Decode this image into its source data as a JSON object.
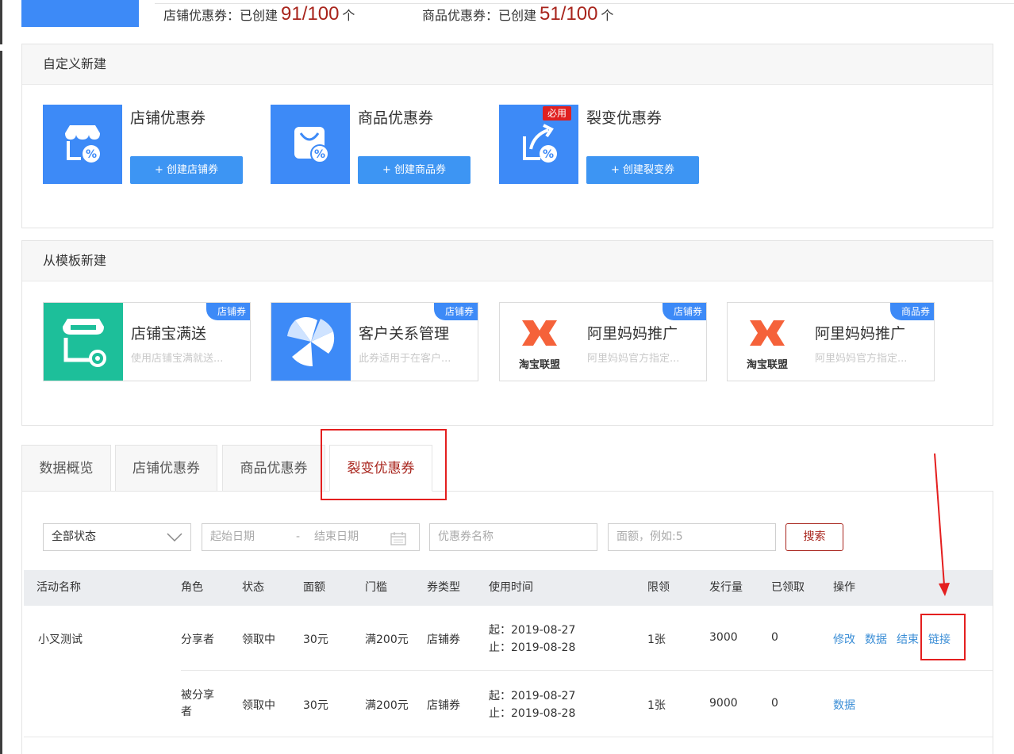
{
  "stats": {
    "shop": {
      "label": "店铺优惠券：已创建",
      "value": "91/100",
      "unit": "个"
    },
    "product": {
      "label": "商品优惠券：已创建",
      "value": "51/100",
      "unit": "个"
    }
  },
  "custom": {
    "title": "自定义新建",
    "cards": [
      {
        "title": "店铺优惠券",
        "button": "+ 创建店铺券",
        "icon": "shop-coupon-icon"
      },
      {
        "title": "商品优惠券",
        "button": "+ 创建商品券",
        "icon": "bag-coupon-icon"
      },
      {
        "title": "裂变优惠券",
        "button": "+ 创建裂变券",
        "icon": "share-coupon-icon",
        "tag": "必用"
      }
    ]
  },
  "template": {
    "title": "从模板新建",
    "cards": [
      {
        "title": "店铺宝满送",
        "desc": "使用店铺宝满就送...",
        "tag": "店铺券"
      },
      {
        "title": "客户关系管理",
        "desc": "此券适用于在客户...",
        "tag": "店铺券"
      },
      {
        "title": "阿里妈妈推广",
        "desc": "阿里妈妈官方指定...",
        "tag": "店铺券",
        "logo_text": "淘宝联盟"
      },
      {
        "title": "阿里妈妈推广",
        "desc": "阿里妈妈官方指定...",
        "tag": "商品券",
        "logo_text": "淘宝联盟"
      }
    ]
  },
  "tabs": [
    "数据概览",
    "店铺优惠券",
    "商品优惠券",
    "裂变优惠券"
  ],
  "filters": {
    "status": "全部状态",
    "start_placeholder": "起始日期",
    "separator": "-",
    "end_placeholder": "结束日期",
    "name_placeholder": "优惠券名称",
    "value_placeholder": "面额，例如:5",
    "search": "搜索"
  },
  "table": {
    "headers": [
      "活动名称",
      "角色",
      "状态",
      "面额",
      "门槛",
      "券类型",
      "使用时间",
      "限领",
      "发行量",
      "已领取",
      "操作"
    ],
    "activity": "小叉测试",
    "rows": [
      {
        "role": "分享者",
        "status": "领取中",
        "value": "30元",
        "threshold": "满200元",
        "type": "店铺券",
        "start": "起：2019-08-27",
        "end": "止：2019-08-28",
        "limit": "1张",
        "issued": "3000",
        "received": "0",
        "actions": [
          "修改",
          "数据",
          "结束",
          "链接"
        ]
      },
      {
        "role": "被分享者",
        "status": "领取中",
        "value": "30元",
        "threshold": "满200元",
        "type": "店铺券",
        "start": "起：2019-08-27",
        "end": "止：2019-08-28",
        "limit": "1张",
        "issued": "9000",
        "received": "0",
        "actions": [
          "数据"
        ]
      }
    ]
  },
  "colors": {
    "brand_blue": "#3d8af7",
    "accent_red": "#a8241c",
    "link_blue": "#3b8ed6",
    "annotation_red": "#e41f1f"
  }
}
